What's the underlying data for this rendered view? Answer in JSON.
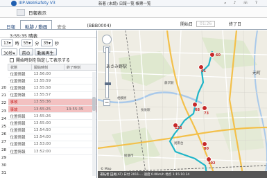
{
  "titlebar": {
    "app_name": "IIIP-WebSafety V3",
    "right_text": "新着 (未読)  日報一覧  帳票一覧",
    "icons": [
      "search-icon",
      "bell-icon",
      "phone-icon",
      "help-icon"
    ]
  },
  "menubar": {
    "label": "日報表示"
  },
  "tabs": {
    "items": [
      "日報",
      "軌跡 / 動画",
      "安全"
    ],
    "code": "(BBB0004)",
    "start_label": "開始日",
    "start_time": "01:26",
    "end_label": "終了日"
  },
  "panel": {
    "time_head": "3:55:35 晴表",
    "ctrl": {
      "hour": "13",
      "hour_unit": "時",
      "min": "55",
      "min_unit": "分",
      "sec": "35",
      "sec_unit": "秒",
      "interval": "30秒",
      "prev_btn": "前の",
      "next_btn": "動画再生"
    },
    "check_label": "開始時刻を指定して表示する",
    "table": {
      "headers": [
        "状態",
        "開始時刻",
        "終了時刻"
      ],
      "rows": [
        {
          "num": "20",
          "status": "位置情報",
          "start": "13:56:00",
          "end": "",
          "hl": false
        },
        {
          "num": "21",
          "status": "位置情報",
          "start": "13:55:59",
          "end": "",
          "hl": false
        },
        {
          "num": "22",
          "status": "位置情報",
          "start": "13:55:58",
          "end": "",
          "hl": false
        },
        {
          "num": "23",
          "status": "位置情報",
          "start": "13:55:57",
          "end": "",
          "hl": false
        },
        {
          "num": "24",
          "status": "事故",
          "start": "13:55:36",
          "end": "",
          "hl": true
        },
        {
          "num": "25",
          "status": "事故",
          "start": "13:55:25",
          "end": "13:55:35",
          "hl": true
        },
        {
          "num": "26",
          "status": "位置情報",
          "start": "13:55:26",
          "end": "",
          "hl": false
        },
        {
          "num": "27",
          "status": "位置情報",
          "start": "13:55:00",
          "end": "",
          "hl": false
        },
        {
          "num": "28",
          "status": "位置情報",
          "start": "13:54:50",
          "end": "",
          "hl": false
        },
        {
          "num": "29",
          "status": "位置情報",
          "start": "13:54:00",
          "end": "",
          "hl": false
        },
        {
          "num": "30",
          "status": "位置情報",
          "start": "13:53:00",
          "end": "",
          "hl": false
        },
        {
          "num": "31",
          "status": "位置情報",
          "start": "13:52:00",
          "end": "",
          "hl": false
        }
      ]
    }
  },
  "map": {
    "labels": {
      "park": "あさみ野駅",
      "station1": "藤沢駅",
      "station2": "長後駅",
      "area1": "相模原",
      "area2": "湘南台",
      "area3": "綾瀬市",
      "north": "元町"
    },
    "markers": [
      {
        "id": "60",
        "label": "60"
      },
      {
        "id": "61",
        "label": "61"
      },
      {
        "id": "68",
        "label": "68"
      },
      {
        "id": "73",
        "label": "73"
      },
      {
        "id": "125",
        "label": "125"
      },
      {
        "id": "80",
        "label": "80"
      },
      {
        "id": "102",
        "label": "102"
      }
    ],
    "colors": {
      "route": "#1fb5c8",
      "road_main": "#f3c04a",
      "water": "#a9c9ea",
      "marker": "#c62828"
    }
  },
  "statusbar": {
    "text": "運転者  田尾(AT)  日付 2011-...  速度 0.0Km/h  地点 1:15:10.14"
  }
}
